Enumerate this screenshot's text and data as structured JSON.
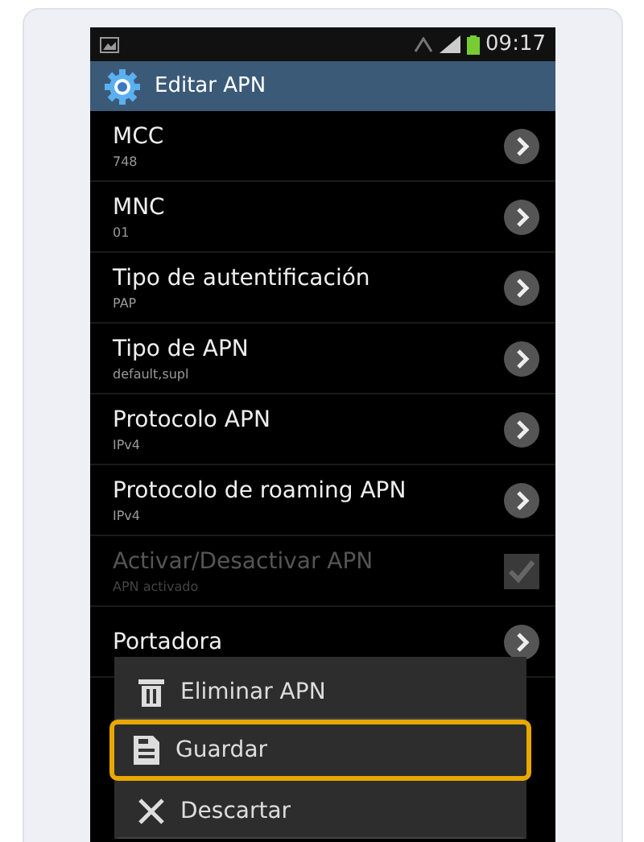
{
  "status_bar": {
    "time": "09:17"
  },
  "header": {
    "title": "Editar APN"
  },
  "settings": [
    {
      "title": "MCC",
      "subtitle": "748",
      "kind": "arrow",
      "disabled": false
    },
    {
      "title": "MNC",
      "subtitle": "01",
      "kind": "arrow",
      "disabled": false
    },
    {
      "title": "Tipo de autentificación",
      "subtitle": "PAP",
      "kind": "arrow",
      "disabled": false
    },
    {
      "title": "Tipo de APN",
      "subtitle": "default,supl",
      "kind": "arrow",
      "disabled": false
    },
    {
      "title": "Protocolo APN",
      "subtitle": "IPv4",
      "kind": "arrow",
      "disabled": false
    },
    {
      "title": "Protocolo de roaming APN",
      "subtitle": "IPv4",
      "kind": "arrow",
      "disabled": false
    },
    {
      "title": "Activar/Desactivar APN",
      "subtitle": "APN activado",
      "kind": "checkbox",
      "checked": true,
      "disabled": true
    },
    {
      "title": "Portadora",
      "kind": "arrow",
      "disabled": false
    }
  ],
  "menu": [
    {
      "label": "Eliminar APN",
      "kind": "delete",
      "selected": false
    },
    {
      "label": "Guardar",
      "kind": "save",
      "selected": true
    },
    {
      "label": "Descartar",
      "kind": "discard",
      "selected": false
    }
  ]
}
